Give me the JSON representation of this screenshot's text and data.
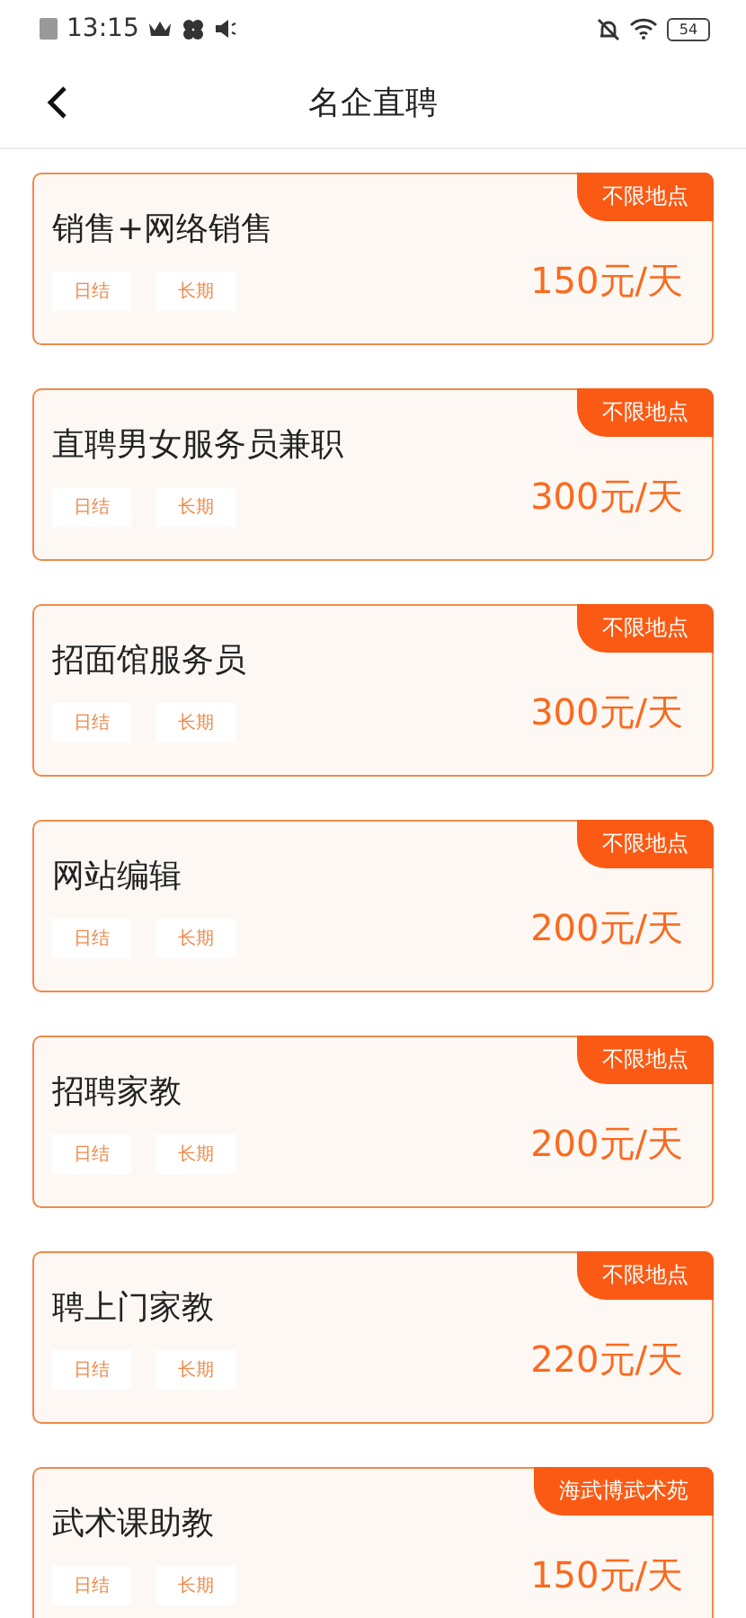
{
  "status_bar": {
    "time": "13:15",
    "battery": "54"
  },
  "header": {
    "title": "名企直聘"
  },
  "jobs": [
    {
      "title": "销售+网络销售",
      "location": "不限地点",
      "tags": [
        "日结",
        "长期"
      ],
      "salary": "150元/天"
    },
    {
      "title": "直聘男女服务员兼职",
      "location": "不限地点",
      "tags": [
        "日结",
        "长期"
      ],
      "salary": "300元/天"
    },
    {
      "title": "招面馆服务员",
      "location": "不限地点",
      "tags": [
        "日结",
        "长期"
      ],
      "salary": "300元/天"
    },
    {
      "title": "网站编辑",
      "location": "不限地点",
      "tags": [
        "日结",
        "长期"
      ],
      "salary": "200元/天"
    },
    {
      "title": "招聘家教",
      "location": "不限地点",
      "tags": [
        "日结",
        "长期"
      ],
      "salary": "200元/天"
    },
    {
      "title": "聘上门家教",
      "location": "不限地点",
      "tags": [
        "日结",
        "长期"
      ],
      "salary": "220元/天"
    },
    {
      "title": "武术课助教",
      "location": "海武博武术苑",
      "tags": [
        "日结",
        "长期"
      ],
      "salary": "150元/天"
    }
  ]
}
